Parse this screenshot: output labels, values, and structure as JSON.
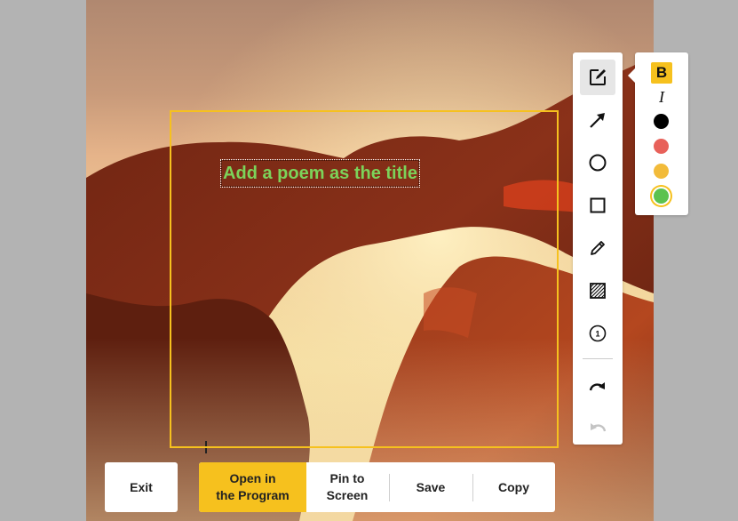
{
  "annotation": {
    "text": "Add a poem as the title",
    "color": "#7cd35a"
  },
  "toolbar": {
    "tools": [
      {
        "id": "text",
        "icon": "text-edit-icon",
        "active": true
      },
      {
        "id": "arrow",
        "icon": "arrow-icon"
      },
      {
        "id": "ellipse",
        "icon": "circle-icon"
      },
      {
        "id": "rectangle",
        "icon": "square-icon"
      },
      {
        "id": "pencil",
        "icon": "pencil-icon"
      },
      {
        "id": "mosaic",
        "icon": "mosaic-icon"
      },
      {
        "id": "number",
        "icon": "number-marker-icon",
        "label": "1"
      },
      {
        "id": "redo",
        "icon": "redo-icon"
      },
      {
        "id": "undo",
        "icon": "undo-icon",
        "disabled": true
      }
    ]
  },
  "style_panel": {
    "bold_label": "B",
    "italic_label": "I",
    "colors": [
      "#000000",
      "#e8615a",
      "#f2bb3a",
      "#5bc24f"
    ],
    "selected_color": "#5bc24f",
    "accent": "#f6c11e"
  },
  "actions": {
    "exit": "Exit",
    "open_line1": "Open in",
    "open_line2": "the Program",
    "pin_line1": "Pin to",
    "pin_line2": "Screen",
    "save": "Save",
    "copy": "Copy"
  }
}
